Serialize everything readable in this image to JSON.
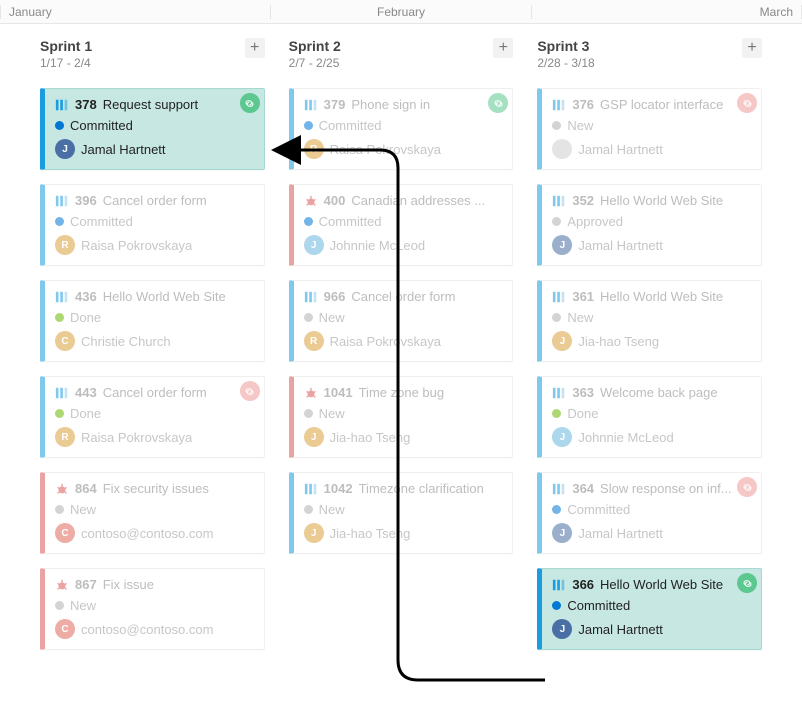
{
  "months": [
    "January",
    "February",
    "March"
  ],
  "icons": {
    "pbi": "product-backlog-item-icon",
    "bug": "bug-icon",
    "link": "link-icon",
    "add": "+"
  },
  "stateColors": {
    "Committed": "#0078d4",
    "New": "#b2b0ad",
    "Done": "#6bb700",
    "Approved": "#b2b0ad"
  },
  "linkBadgeColors": {
    "green": "#5cc78f",
    "red": "#ef9a9a"
  },
  "avatarPalette": {
    "Jamal Hartnett": {
      "bg": "#4a6fa5",
      "initial": "J"
    },
    "Raisa Pokrovskaya": {
      "bg": "#d9a13b",
      "initial": "R"
    },
    "Christie Church": {
      "bg": "#d9a13b",
      "initial": "C"
    },
    "Johnnie McLeod": {
      "bg": "#6bb7e0",
      "initial": "J"
    },
    "Jia-hao Tseng": {
      "bg": "#d9a13b",
      "initial": "J"
    },
    "contoso@contoso.com": {
      "bg": "#e06a5a",
      "initial": "C"
    },
    "_anon": {
      "bg": "#cfcfcf",
      "initial": ""
    }
  },
  "sprints": [
    {
      "title": "Sprint 1",
      "dates": "1/17 - 2/4",
      "cards": [
        {
          "type": "pbi",
          "id": 378,
          "title": "Request support",
          "state": "Committed",
          "assignee": "Jamal Hartnett",
          "badge": "green",
          "highlight": true,
          "border": "#1a9de0"
        },
        {
          "type": "pbi",
          "id": 396,
          "title": "Cancel order form",
          "state": "Committed",
          "assignee": "Raisa Pokrovskaya",
          "border": "#1a9de0"
        },
        {
          "type": "pbi",
          "id": 436,
          "title": "Hello World Web Site",
          "state": "Done",
          "assignee": "Christie Church",
          "border": "#1a9de0"
        },
        {
          "type": "pbi",
          "id": 443,
          "title": "Cancel order form",
          "state": "Done",
          "assignee": "Raisa Pokrovskaya",
          "badge": "red",
          "border": "#1a9de0"
        },
        {
          "type": "bug",
          "id": 864,
          "title": "Fix security issues",
          "state": "New",
          "assignee": "contoso@contoso.com",
          "border": "#d85959"
        },
        {
          "type": "bug",
          "id": 867,
          "title": "Fix issue",
          "state": "New",
          "assignee": "contoso@contoso.com",
          "border": "#d85959"
        }
      ]
    },
    {
      "title": "Sprint 2",
      "dates": "2/7 - 2/25",
      "cards": [
        {
          "type": "pbi",
          "id": 379,
          "title": "Phone sign in",
          "state": "Committed",
          "assignee": "Raisa Pokrovskaya",
          "badge": "green",
          "border": "#1a9de0"
        },
        {
          "type": "bug",
          "id": 400,
          "title": "Canadian addresses ...",
          "state": "Committed",
          "assignee": "Johnnie McLeod",
          "border": "#d85959"
        },
        {
          "type": "pbi",
          "id": 966,
          "title": "Cancel order form",
          "state": "New",
          "assignee": "Raisa Pokrovskaya",
          "border": "#1a9de0"
        },
        {
          "type": "bug",
          "id": 1041,
          "title": "Time zone bug",
          "state": "New",
          "assignee": "Jia-hao Tseng",
          "border": "#d85959"
        },
        {
          "type": "pbi",
          "id": 1042,
          "title": "Timezone clarification",
          "state": "New",
          "assignee": "Jia-hao Tseng",
          "border": "#1a9de0"
        }
      ]
    },
    {
      "title": "Sprint 3",
      "dates": "2/28 - 3/18",
      "cards": [
        {
          "type": "pbi",
          "id": 376,
          "title": "GSP locator interface",
          "state": "New",
          "assignee": "_anon",
          "assigneeLabel": "Jamal Hartnett",
          "badge": "red",
          "border": "#1a9de0"
        },
        {
          "type": "pbi",
          "id": 352,
          "title": "Hello World Web Site",
          "state": "Approved",
          "assignee": "Jamal Hartnett",
          "border": "#1a9de0"
        },
        {
          "type": "pbi",
          "id": 361,
          "title": "Hello World Web Site",
          "state": "New",
          "assignee": "Jia-hao Tseng",
          "border": "#1a9de0"
        },
        {
          "type": "pbi",
          "id": 363,
          "title": "Welcome back page",
          "state": "Done",
          "assignee": "Johnnie McLeod",
          "border": "#1a9de0"
        },
        {
          "type": "pbi",
          "id": 364,
          "title": "Slow response on inf...",
          "state": "Committed",
          "assignee": "Jamal Hartnett",
          "badge": "red",
          "border": "#1a9de0"
        },
        {
          "type": "pbi",
          "id": 366,
          "title": "Hello World Web Site",
          "state": "Committed",
          "assignee": "Jamal Hartnett",
          "badge": "green",
          "highlight": true,
          "border": "#1a9de0"
        }
      ]
    }
  ]
}
